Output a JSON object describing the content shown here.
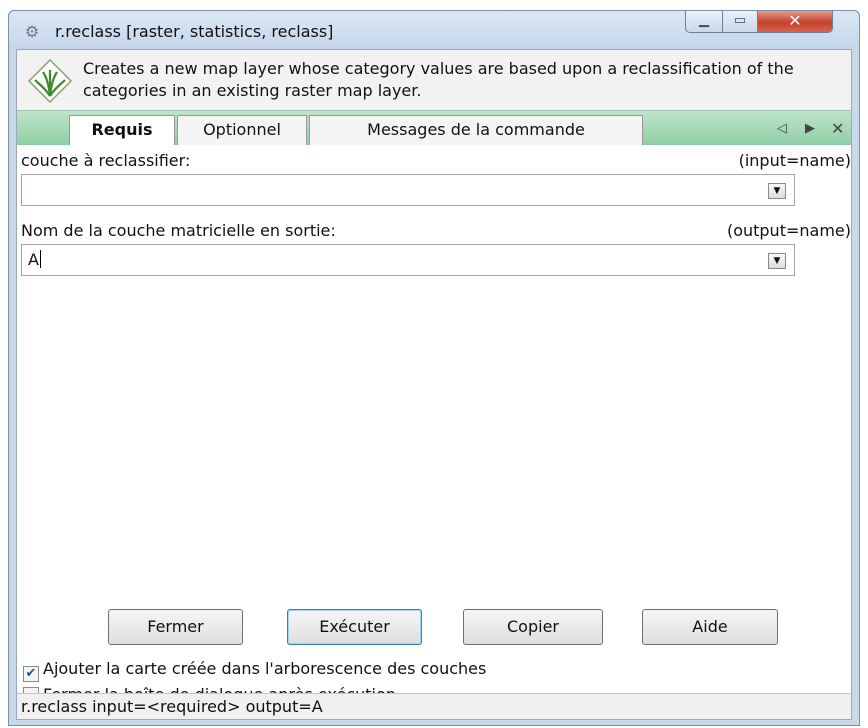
{
  "window": {
    "title": "r.reclass [raster, statistics, reclass]",
    "icon": "gear-icon",
    "minimize_icon": "minimize-icon",
    "maximize_icon": "maximize-icon",
    "close_icon": "close-icon"
  },
  "description": "Creates a new map layer whose category values are based upon a reclassification of the categories in an existing raster map layer.",
  "tabs": [
    {
      "label": "Requis",
      "active": true
    },
    {
      "label": "Optionnel",
      "active": false
    },
    {
      "label": "Messages de la commande",
      "active": false
    }
  ],
  "tab_nav": {
    "prev": "◁",
    "next": "▶",
    "close": "✕"
  },
  "fields": {
    "input": {
      "label": "couche à reclassifier:",
      "hint": "(input=name)",
      "value": ""
    },
    "output": {
      "label": "Nom de la couche matricielle en sortie:",
      "hint": "(output=name)",
      "value": "A"
    }
  },
  "buttons": {
    "fermer": "Fermer",
    "executer": "Exécuter",
    "copier": "Copier",
    "aide": "Aide"
  },
  "checkboxes": {
    "add_to_tree": {
      "label": "Ajouter la carte créée dans l'arborescence des couches",
      "checked": true
    },
    "close_after": {
      "label": "Fermer la boîte de dialogue après exécution",
      "checked": false
    }
  },
  "statusbar": "r.reclass input=<required> output=A",
  "colors": {
    "tab_strip": "#8fcfa5",
    "close_button": "#c4412d",
    "title_bar": "#c5d6ea"
  }
}
